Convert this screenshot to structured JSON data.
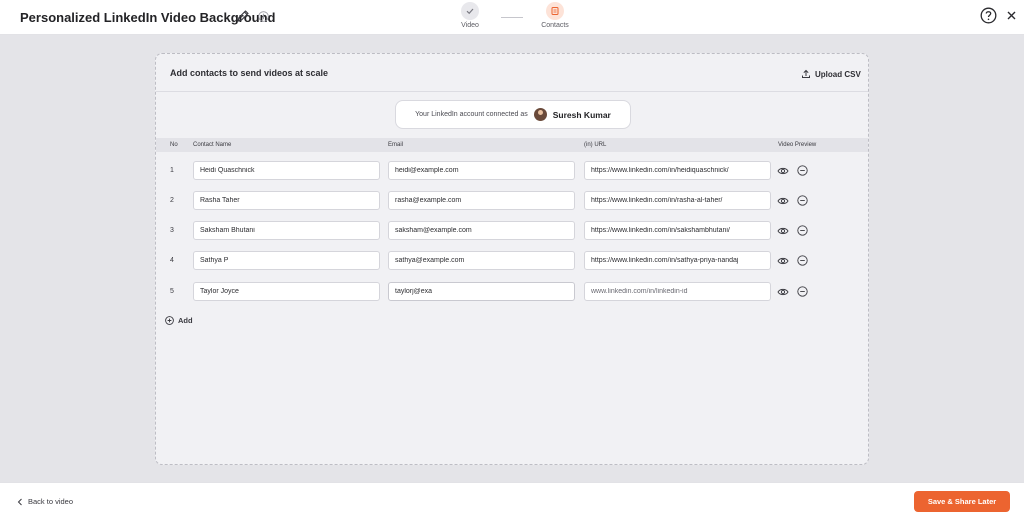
{
  "header": {
    "title": "Personalized LinkedIn Video Background",
    "steps": [
      {
        "label": "Video",
        "state": "done"
      },
      {
        "label": "Contacts",
        "state": "active"
      }
    ]
  },
  "card": {
    "title": "Add contacts to send videos at scale",
    "upload_label": "Upload CSV",
    "account": {
      "prefix": "Your LinkedIn account connected as",
      "name": "Suresh Kumar"
    },
    "columns": {
      "no": "No",
      "name": "Contact Name",
      "email": "Email",
      "url": "(in) URL",
      "preview": "Video Preview"
    },
    "rows": [
      {
        "no": "1",
        "name": "Heidi Quaschnick",
        "email": "heidi@example.com",
        "url": "https://www.linkedin.com/in/heidiquaschnick/"
      },
      {
        "no": "2",
        "name": "Rasha Taher",
        "email": "rasha@example.com",
        "url": "https://www.linkedin.com/in/rasha-al-taher/"
      },
      {
        "no": "3",
        "name": "Saksham Bhutani",
        "email": "saksham@example.com",
        "url": "https://www.linkedin.com/in/sakshambhutani/"
      },
      {
        "no": "4",
        "name": "Sathya P",
        "email": "sathya@example.com",
        "url": "https://www.linkedin.com/in/sathya-priya-nandaj"
      },
      {
        "no": "5",
        "name": "Taylor Joyce",
        "email": "taylorj@exa",
        "url": ""
      }
    ],
    "url_placeholder": "www.linkedin.com/in/linkedin-id",
    "add_label": "Add"
  },
  "footer": {
    "back_label": "Back to video",
    "save_label": "Save & Share Later"
  },
  "colors": {
    "accent": "#ec6430",
    "background": "#e4e4e8",
    "card": "#f1f1f4"
  }
}
